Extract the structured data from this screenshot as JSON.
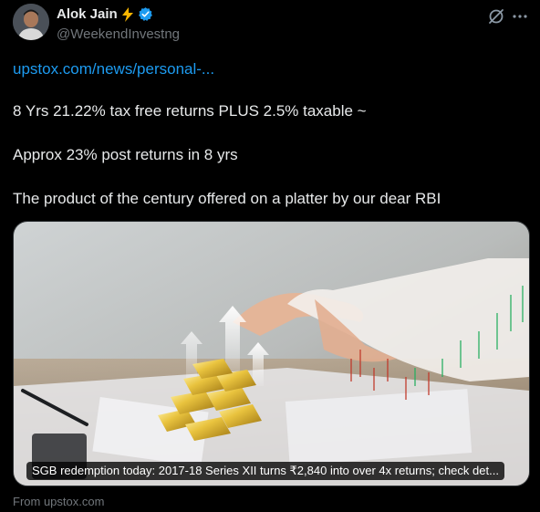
{
  "author": {
    "name": "Alok Jain",
    "handle": "@WeekendInvestng",
    "verified": true,
    "emoji_icon": "lightning-bolt-icon"
  },
  "header_actions": {
    "grok_icon": "grok-icon",
    "more_icon": "more-horizontal-icon"
  },
  "tweet": {
    "link_text": "upstox.com/news/personal-...",
    "line1": "8 Yrs 21.22% tax free returns PLUS 2.5% taxable ~",
    "line2": "Approx 23% post returns in 8 yrs",
    "line3": "The product of the century offered on a platter by our dear RBI"
  },
  "card": {
    "caption": "SGB redemption today: 2017-18 Series XII turns ₹2,840 into over 4x returns; check det...",
    "source": "From upstox.com"
  },
  "colors": {
    "background": "#000000",
    "text": "#e7e9ea",
    "muted": "#71767b",
    "link": "#1d9bf0",
    "verified": "#1d9bf0",
    "bolt": "#f7b500"
  }
}
